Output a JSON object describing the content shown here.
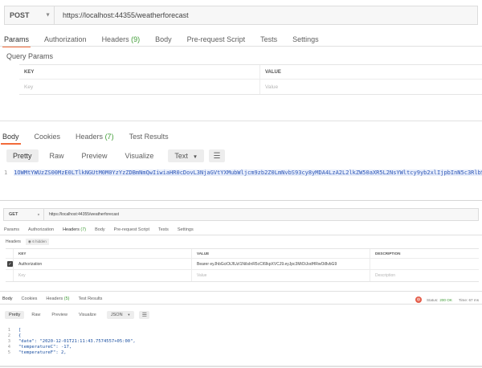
{
  "top": {
    "method": "POST",
    "url": "https://localhost:44355/weatherforecast",
    "request_tabs": [
      {
        "label": "Params",
        "count": ""
      },
      {
        "label": "Authorization",
        "count": ""
      },
      {
        "label": "Headers",
        "count": " (9)"
      },
      {
        "label": "Body",
        "count": ""
      },
      {
        "label": "Pre-request Script",
        "count": ""
      },
      {
        "label": "Tests",
        "count": ""
      },
      {
        "label": "Settings",
        "count": ""
      }
    ],
    "query_params_label": "Query Params",
    "table": {
      "key_header": "KEY",
      "value_header": "VALUE",
      "key_placeholder": "Key",
      "value_placeholder": "Value"
    },
    "response_tabs": [
      {
        "label": "Body",
        "count": ""
      },
      {
        "label": "Cookies",
        "count": ""
      },
      {
        "label": "Headers",
        "count": " (7)"
      },
      {
        "label": "Test Results",
        "count": ""
      }
    ],
    "view_buttons": [
      "Pretty",
      "Raw",
      "Preview",
      "Visualize"
    ],
    "format": "Text",
    "line_number": "1",
    "response_text": "1OWMtYWUzZS00MzE0LTlkNGUtM0M0YzYzZDBmNmQwIiwiaHR0cDovL3NjaGVtYXMubWljcm9zb2Z0LmNvbS93cy8yMDA4LzA2L2lkZW50aXR5L2NsYWltcy9yb2xlIjpbInN5c3RlbSIsInRlc3QiXSwibmJmIjoxNjA4"
  },
  "bottom": {
    "method": "GET",
    "url": "https://localhost:44355/weatherforecast",
    "request_tabs": [
      {
        "label": "Params",
        "count": ""
      },
      {
        "label": "Authorization",
        "count": ""
      },
      {
        "label": "Headers",
        "count": " (7)"
      },
      {
        "label": "Body",
        "count": ""
      },
      {
        "label": "Pre-request Script",
        "count": ""
      },
      {
        "label": "Tests",
        "count": ""
      },
      {
        "label": "Settings",
        "count": ""
      }
    ],
    "headers_label": "Headers",
    "hidden_label": "6 hidden",
    "table": {
      "key_header": "KEY",
      "value_header": "VALUE",
      "desc_header": "DESCRIPTION",
      "row_key": "Authorization",
      "row_value": "Bearer eyJhbGciOiJIUzI1NiIsInR5cCI6IkpXVCJ9.eyJpc3MiOiJodHRwOi8vbG9",
      "key_placeholder": "Key",
      "value_placeholder": "Value",
      "desc_placeholder": "Description"
    },
    "response_tabs": [
      {
        "label": "Body",
        "count": ""
      },
      {
        "label": "Cookies",
        "count": ""
      },
      {
        "label": "Headers",
        "count": " (5)"
      },
      {
        "label": "Test Results",
        "count": ""
      }
    ],
    "status_label": "Status:",
    "status_value": "200 OK",
    "time_label": "Time: 67 ms",
    "view_buttons": [
      "Pretty",
      "Raw",
      "Preview",
      "Visualize"
    ],
    "format": "JSON",
    "code_lines": [
      {
        "n": "1",
        "text": "["
      },
      {
        "n": "2",
        "text": "    {"
      },
      {
        "n": "3",
        "text": "        \"date\": \"2020-12-01T21:11:43.7574557+05:00\","
      },
      {
        "n": "4",
        "text": "        \"temperatureC\": -17,"
      },
      {
        "n": "5",
        "text": "        \"temperatureF\": 2,"
      }
    ]
  }
}
